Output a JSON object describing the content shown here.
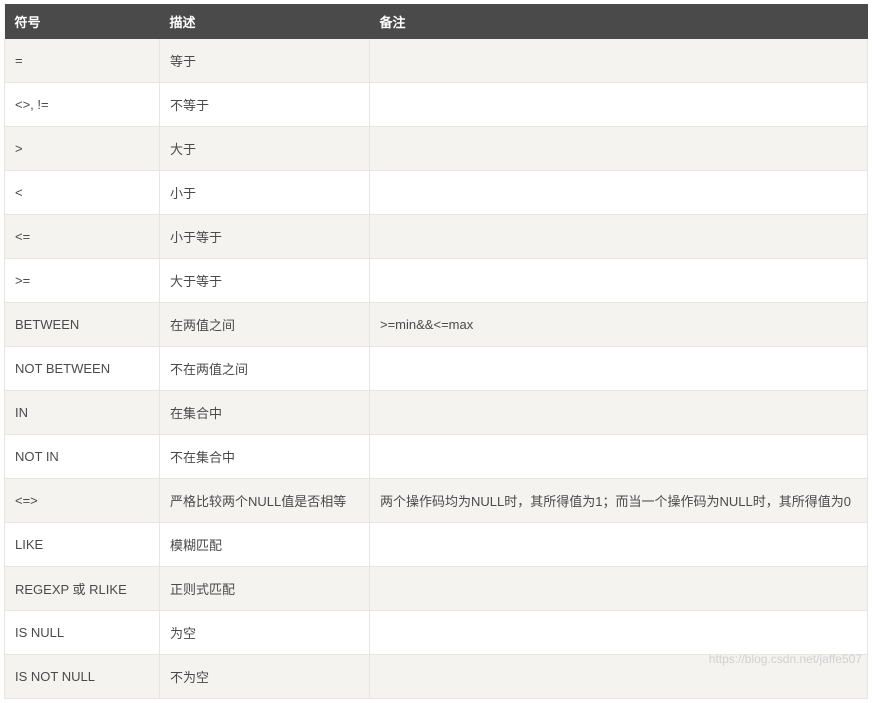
{
  "headers": {
    "symbol": "符号",
    "description": "描述",
    "remark": "备注"
  },
  "rows": [
    {
      "symbol": "=",
      "description": "等于",
      "remark": ""
    },
    {
      "symbol": "<>, !=",
      "description": "不等于",
      "remark": ""
    },
    {
      "symbol": ">",
      "description": "大于",
      "remark": ""
    },
    {
      "symbol": "<",
      "description": "小于",
      "remark": ""
    },
    {
      "symbol": "<=",
      "description": "小于等于",
      "remark": ""
    },
    {
      "symbol": ">=",
      "description": "大于等于",
      "remark": ""
    },
    {
      "symbol": "BETWEEN",
      "description": "在两值之间",
      "remark": ">=min&&<=max"
    },
    {
      "symbol": "NOT BETWEEN",
      "description": "不在两值之间",
      "remark": ""
    },
    {
      "symbol": "IN",
      "description": "在集合中",
      "remark": ""
    },
    {
      "symbol": "NOT IN",
      "description": "不在集合中",
      "remark": ""
    },
    {
      "symbol": "<=>",
      "description": "严格比较两个NULL值是否相等",
      "remark": "两个操作码均为NULL时，其所得值为1；而当一个操作码为NULL时，其所得值为0"
    },
    {
      "symbol": "LIKE",
      "description": "模糊匹配",
      "remark": ""
    },
    {
      "symbol": "REGEXP 或 RLIKE",
      "description": "正则式匹配",
      "remark": ""
    },
    {
      "symbol": "IS NULL",
      "description": "为空",
      "remark": ""
    },
    {
      "symbol": "IS NOT NULL",
      "description": "不为空",
      "remark": ""
    }
  ],
  "watermark": "https://blog.csdn.net/jaffe507"
}
